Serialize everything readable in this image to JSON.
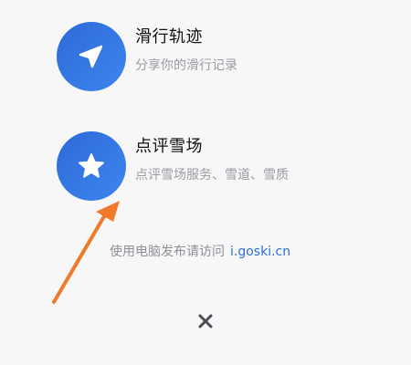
{
  "menu": {
    "items": [
      {
        "title": "滑行轨迹",
        "subtitle": "分享你的滑行记录",
        "icon": "send-arrow-icon"
      },
      {
        "title": "点评雪场",
        "subtitle": "点评雪场服务、雪道、雪质",
        "icon": "star-icon"
      }
    ]
  },
  "hint": {
    "text": "使用电脑发布请访问",
    "link": "i.goski.cn"
  },
  "close": {
    "icon": "close-icon"
  },
  "annotation": {
    "icon": "arrow-annotation-icon",
    "color": "#f07a2a"
  },
  "colors": {
    "icon_gradient_start": "#2c6ad8",
    "icon_gradient_end": "#3f86ee",
    "link": "#2f6fd1",
    "background": "#f7f7f8"
  }
}
